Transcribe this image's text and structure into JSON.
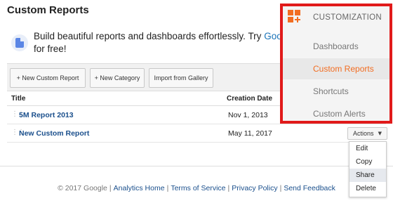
{
  "header": {
    "title": "Custom Reports"
  },
  "promo": {
    "icon": "document-icon",
    "text_line1": "Build beautiful reports and dashboards effortlessly. Try ",
    "link_text": "Goog",
    "text_line2": "for free!"
  },
  "toolbar": {
    "new_report": "+ New Custom Report",
    "new_category": "+ New Category",
    "import": "Import from Gallery"
  },
  "table": {
    "columns": [
      "Title",
      "Creation Date"
    ],
    "rows": [
      {
        "title": "5M Report 2013",
        "date": "Nov 1, 2013"
      },
      {
        "title": "New Custom Report",
        "date": "May 11, 2017"
      }
    ],
    "actions_label": "Actions"
  },
  "actions_menu": {
    "items": [
      "Edit",
      "Copy",
      "Share",
      "Delete"
    ],
    "highlighted": "Share"
  },
  "footer": {
    "copyright": "© 2017 Google",
    "links": [
      "Analytics Home",
      "Terms of Service",
      "Privacy Policy",
      "Send Feedback"
    ]
  },
  "customization_menu": {
    "title": "CUSTOMIZATION",
    "items": [
      "Dashboards",
      "Custom Reports",
      "Shortcuts",
      "Custom Alerts"
    ],
    "active": "Custom Reports",
    "accent_color": "#f26d21",
    "highlight_border_color": "#e11a1a"
  }
}
